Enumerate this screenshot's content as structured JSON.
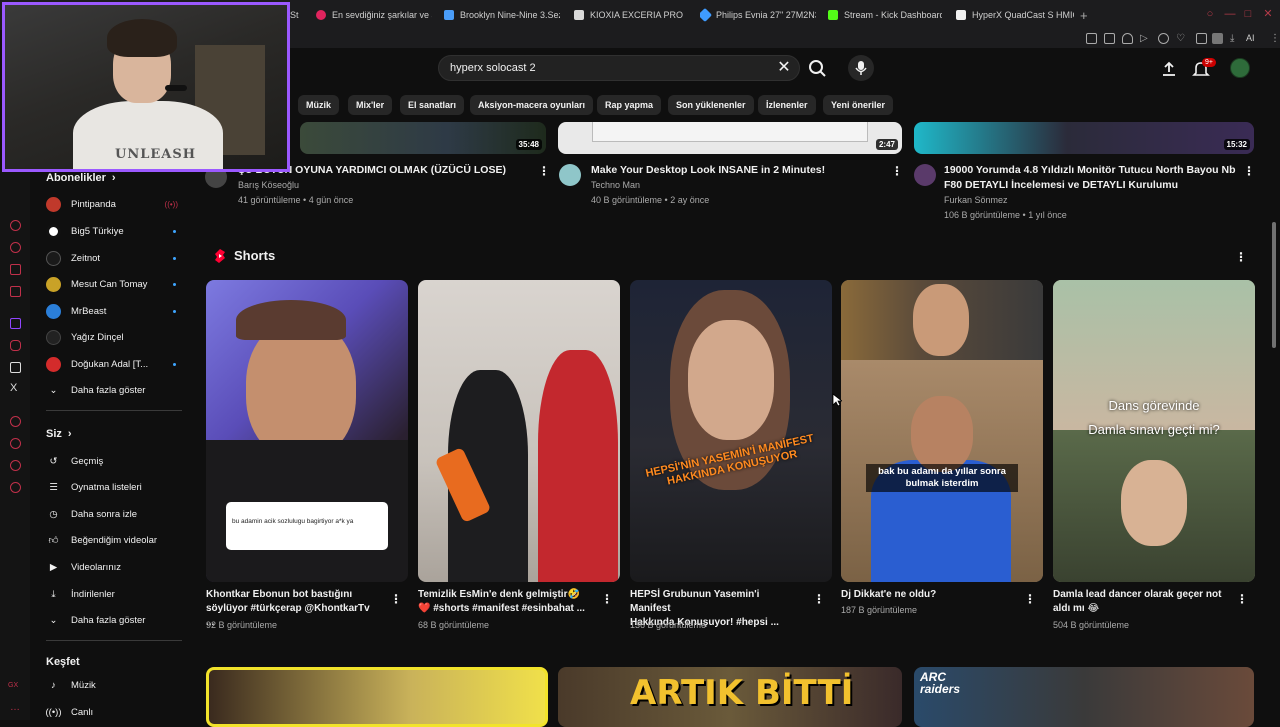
{
  "browser": {
    "tabs": [
      {
        "label": "St",
        "color": "#555"
      },
      {
        "label": "En sevdiğiniz şarkılar ve a",
        "color": "#e0245e"
      },
      {
        "label": "Brooklyn Nine-Nine 3.Sez",
        "color": "#4a9df8"
      },
      {
        "label": "KIOXIA EXCERIA PRO 1TB",
        "color": "#d9d9d9"
      },
      {
        "label": "Philips Evnia 27\" 27M2N3",
        "color": "#3e9bff"
      },
      {
        "label": "Stream - Kick Dashboard",
        "color": "#53fc18"
      },
      {
        "label": "HyperX QuadCast S HMIC",
        "color": "#f1f1f1"
      }
    ],
    "new_tab": "+",
    "ai_label": "AI"
  },
  "search": {
    "query": "hyperx solocast 2",
    "clear": "✕"
  },
  "header": {
    "notification_badge": "9+"
  },
  "chips": [
    "Müzik",
    "Mix'ler",
    "El sanatları",
    "Aksiyon-macera oyunları",
    "Rap yapma",
    "Son yüklenenler",
    "İzlenenler",
    "Yeni öneriler"
  ],
  "sidebar": {
    "subscriptions_title": "Abonelikler",
    "subscriptions": [
      {
        "name": "Pintipanda",
        "color": "#c0392b",
        "status": "live"
      },
      {
        "name": "Big5 Türkiye",
        "color": "#ffffff",
        "status": "dot"
      },
      {
        "name": "Zeitnot",
        "color": "#1a1a1a",
        "status": "dot"
      },
      {
        "name": "Mesut Can Tomay",
        "color": "#c9a227",
        "status": "dot"
      },
      {
        "name": "MrBeast",
        "color": "#2b7fd9",
        "status": "dot"
      },
      {
        "name": "Yağız Dinçel",
        "color": "#222",
        "status": ""
      },
      {
        "name": "Doğukan Adal [T...",
        "color": "#d42b2b",
        "status": "dot"
      }
    ],
    "show_more": "Daha fazla göster",
    "you_title": "Siz",
    "you_items": [
      "Geçmiş",
      "Oynatma listeleri",
      "Daha sonra izle",
      "Beğendiğim videolar",
      "Videolarınız",
      "İndirilenler",
      "Daha fazla göster"
    ],
    "explore_title": "Keşfet",
    "explore_items": [
      "Müzik",
      "Canlı"
    ]
  },
  "videos": [
    {
      "title": "ŞU BÜTÜN OYUNA YARDIMCI OLMAK (ÜZÜCÜ LOSE)",
      "channel": "Barış Köseoğlu",
      "stats": "41 görüntüleme • 4 gün önce",
      "duration": "35:48"
    },
    {
      "title": "Make Your Desktop Look INSANE in 2 Minutes!",
      "channel": "Techno Man",
      "stats": "40 B görüntüleme • 2 ay önce",
      "duration": "2:47"
    },
    {
      "title_line1": "19000 Yorumda 4.8 Yıldızlı Monitör Tutucu North Bayou Nb",
      "title_line2": "F80 DETAYLI İncelemesi ve DETAYLI Kurulumu",
      "channel": "Furkan Sönmez",
      "stats": "106 B görüntüleme • 1 yıl önce",
      "duration": "15:32"
    }
  ],
  "shorts": {
    "title": "Shorts",
    "items": [
      {
        "line1": "Khontkar Ebonun bot bastığını",
        "line2": "söylüyor #türkçerap @KhontkarTv ...",
        "views": "92 B görüntüleme",
        "overlay": "bu adamin acik sozlulugu bagirtiyor a*k ya"
      },
      {
        "line1": "Temizlik EsMin'e denk gelmiştir🤣",
        "line2": "❤️ #shorts #manifest #esinbahat ...",
        "views": "68 B görüntüleme",
        "overlay": ""
      },
      {
        "line1": "HEPSİ Grubunun Yasemin'i Manifest",
        "line2": "Hakkında Konuşuyor! #hepsi ...",
        "views": "136 B görüntüleme",
        "overlay": "HEPSİ'NİN YASEMİN'İ MANİFEST HAKKINDA KONUŞUYOR"
      },
      {
        "line1": "Dj Dikkat'e ne oldu?",
        "line2": "",
        "views": "187 B görüntüleme",
        "overlay": "bak bu adamı da yıllar sonra bulmak isterdim"
      },
      {
        "line1": "Damla lead dancer olarak geçer not",
        "line2": "aldı mı 😂",
        "views": "504 B görüntüleme",
        "overlay1": "Dans görevinde",
        "overlay2": "Damla sınavı geçti mi?"
      }
    ]
  },
  "bottom_row": {
    "thumb2_text": "ARTIK BİTTİ",
    "thumb3_text": "ARC raiders"
  },
  "webcam": {
    "shirt_text": "UNLEASH"
  }
}
